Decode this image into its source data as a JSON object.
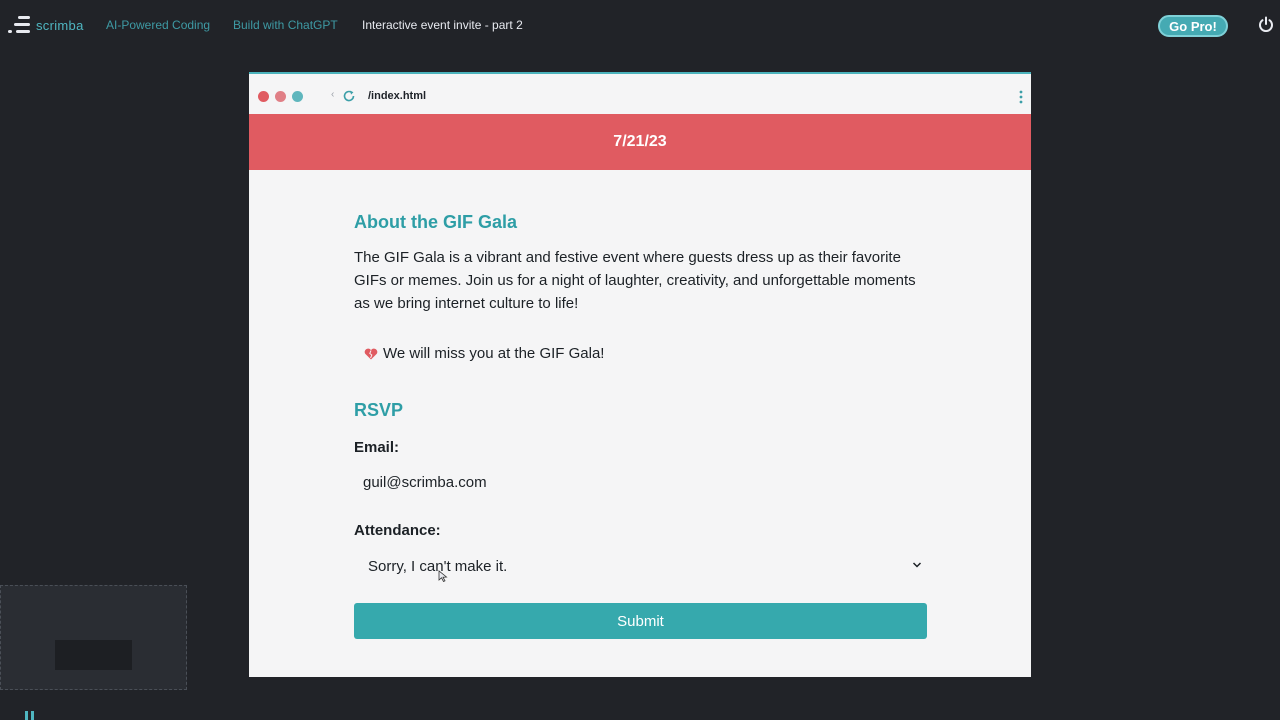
{
  "app": {
    "brand": "scrimba",
    "breadcrumbs": [
      "AI-Powered Coding",
      "Build with ChatGPT",
      "Interactive event invite - part 2"
    ],
    "go_pro_label": "Go Pro!"
  },
  "browser": {
    "url": "/index.html"
  },
  "page": {
    "date": "7/21/23",
    "about_heading": "About the GIF Gala",
    "about_text": "The GIF Gala is a vibrant and festive event where guests dress up as their favorite GIFs or memes. Join us for a night of laughter, creativity, and unforgettable moments as we bring internet culture to life!",
    "miss_message": "We will miss you at the GIF Gala!",
    "rsvp_heading": "RSVP",
    "email_label": "Email:",
    "email_value": "guil@scrimba.com",
    "attendance_label": "Attendance:",
    "attendance_value": "Sorry, I can't make it.",
    "submit_label": "Submit"
  },
  "colors": {
    "accent": "#2e9ea6",
    "banner": "#e05b61",
    "button": "#36a9ad"
  }
}
